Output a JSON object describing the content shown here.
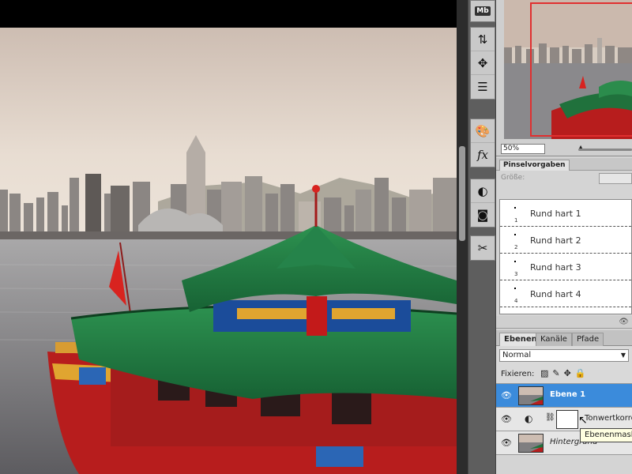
{
  "navigator": {
    "zoom": "50%"
  },
  "toolstrip": {
    "buttons": [
      {
        "name": "minibridge-icon",
        "label": "Mb"
      },
      {
        "name": "history-icon",
        "glyph": "⇅"
      },
      {
        "name": "actions-icon",
        "glyph": "✥"
      },
      {
        "name": "tool-presets-icon",
        "glyph": "☰"
      },
      {
        "name": "swatches-icon",
        "glyph": "🎨"
      },
      {
        "name": "styles-icon",
        "glyph": "fx"
      },
      {
        "name": "adjustments-icon",
        "glyph": "◐"
      },
      {
        "name": "masks-icon",
        "glyph": "◙"
      },
      {
        "name": "brush-preset-icon",
        "glyph": "✂"
      }
    ]
  },
  "brush_presets": {
    "tab": "Pinselvorgaben",
    "size_label": "Größe:",
    "items": [
      {
        "name": "Rund hart 1",
        "num": "1"
      },
      {
        "name": "Rund hart 2",
        "num": "2"
      },
      {
        "name": "Rund hart 3",
        "num": "3"
      },
      {
        "name": "Rund hart 4",
        "num": "4"
      }
    ]
  },
  "layers_panel": {
    "tabs": [
      "Ebenen",
      "Kanäle",
      "Pfade"
    ],
    "blend_mode": "Normal",
    "lock_label": "Fixieren:",
    "layers": [
      {
        "name": "Ebene 1",
        "selected": true
      },
      {
        "name": "Tonwertkorrektur",
        "selected": false
      },
      {
        "name": "Hintergrund",
        "selected": false
      }
    ],
    "tooltip": "Ebenenmaske"
  },
  "colors": {
    "selection": "#3b8bdb",
    "nav_box": "#e03030",
    "roof_green": "#1f7a3e",
    "boat_red": "#c31a1a"
  }
}
